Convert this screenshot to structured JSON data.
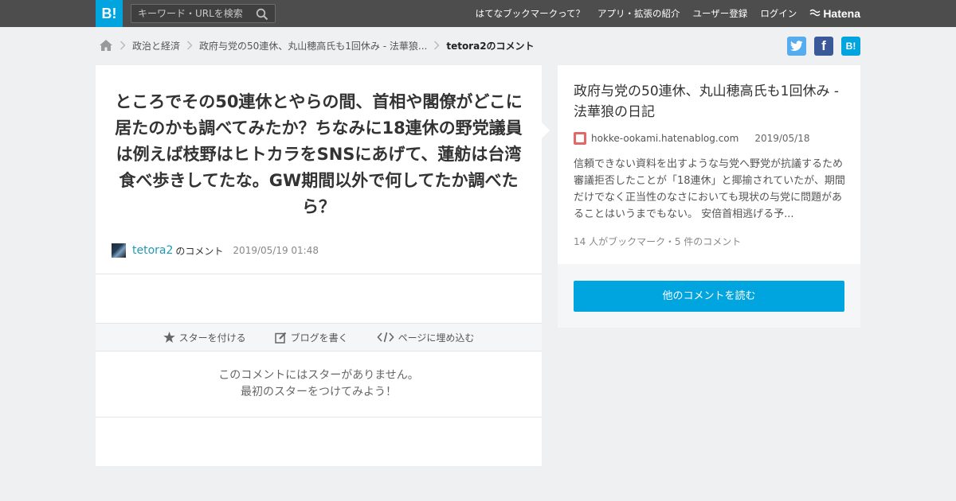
{
  "header": {
    "logo_text": "B!",
    "search_placeholder": "キーワード・URLを検索",
    "nav": [
      "はてなブックマークって？",
      "アプリ・拡張の紹介",
      "ユーザー登録",
      "ログイン"
    ],
    "brand": "Hatena"
  },
  "breadcrumb": {
    "items": [
      "政治と経済",
      "政府与党の50連休、丸山穂高氏も1回休み - 法華狼...",
      "tetora2のコメント"
    ]
  },
  "share": {
    "facebook_label": "f",
    "hatena_label": "B!"
  },
  "comment": {
    "text": "ところでその50連休とやらの間、首相や閣僚がどこに居たのかも調べてみたか？ちなみに18連休の野党議員は例えば枝野はヒトカラをSNSにあげて、蓮舫は台湾食べ歩きしてたな。GW期間以外で何してたか調べたら？",
    "username": "tetora2",
    "username_suffix": "のコメント",
    "datetime": "2019/05/19 01:48"
  },
  "actions": {
    "star": "スターを付ける",
    "blog": "ブログを書く",
    "embed": "ページに埋め込む"
  },
  "stars": {
    "line1": "このコメントにはスターがありません。",
    "line2": "最初のスターをつけてみよう！"
  },
  "entry": {
    "title": "政府与党の50連休、丸山穂高氏も1回休み - 法華狼の日記",
    "domain": "hokke-ookami.hatenablog.com",
    "date": "2019/05/18",
    "summary": "信頼できない資料を出すような与党へ野党が抗議するため審議拒否したことが「18連休」と揶揄されていたが、期間だけでなく正当性のなさにおいても現状の与党に問題があることはいうまでもない。 安倍首相逃げる予...",
    "bookmark_info": "14 人がブックマーク・5 件のコメント",
    "more_button": "他のコメントを読む"
  },
  "colors": {
    "accent": "#00a4de",
    "topbar": "#4d4d4d",
    "background": "#eef0f2",
    "username": "#1d9ab9"
  }
}
